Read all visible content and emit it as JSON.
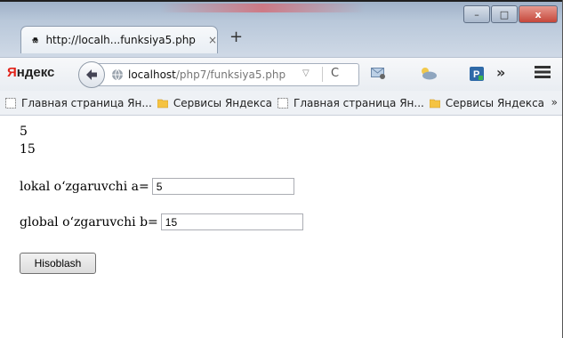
{
  "window": {
    "minimize_glyph": "–",
    "maximize_glyph": "□",
    "close_glyph": "x"
  },
  "tab": {
    "title": "http://localh...funksiya5.php",
    "close_glyph": "×",
    "new_tab_glyph": "+"
  },
  "navbar": {
    "brand_first": "Я",
    "brand_rest": "ндекс",
    "url_host": "localhost",
    "url_path": "/php7/funksiya5.php",
    "more_glyph": "»"
  },
  "bookmarks": {
    "items": [
      {
        "label": "Главная страница Ян...",
        "icon": "page-icon"
      },
      {
        "label": "Сервисы Яндекса",
        "icon": "folder-icon"
      },
      {
        "label": "Главная страница Ян...",
        "icon": "page-icon"
      },
      {
        "label": "Сервисы Яндекса",
        "icon": "folder-icon"
      }
    ],
    "overflow_glyph": "»"
  },
  "page": {
    "output_line1": "5",
    "output_line2": "15",
    "local_label": "lokal o‘zgaruvchi a=",
    "local_value": "5",
    "global_label": "global o‘zgaruvchi b=",
    "global_value": "15",
    "button_label": "Hisoblash"
  },
  "colors": {
    "brand_red": "#e2231a",
    "chrome_blue": "#b9c8da"
  }
}
